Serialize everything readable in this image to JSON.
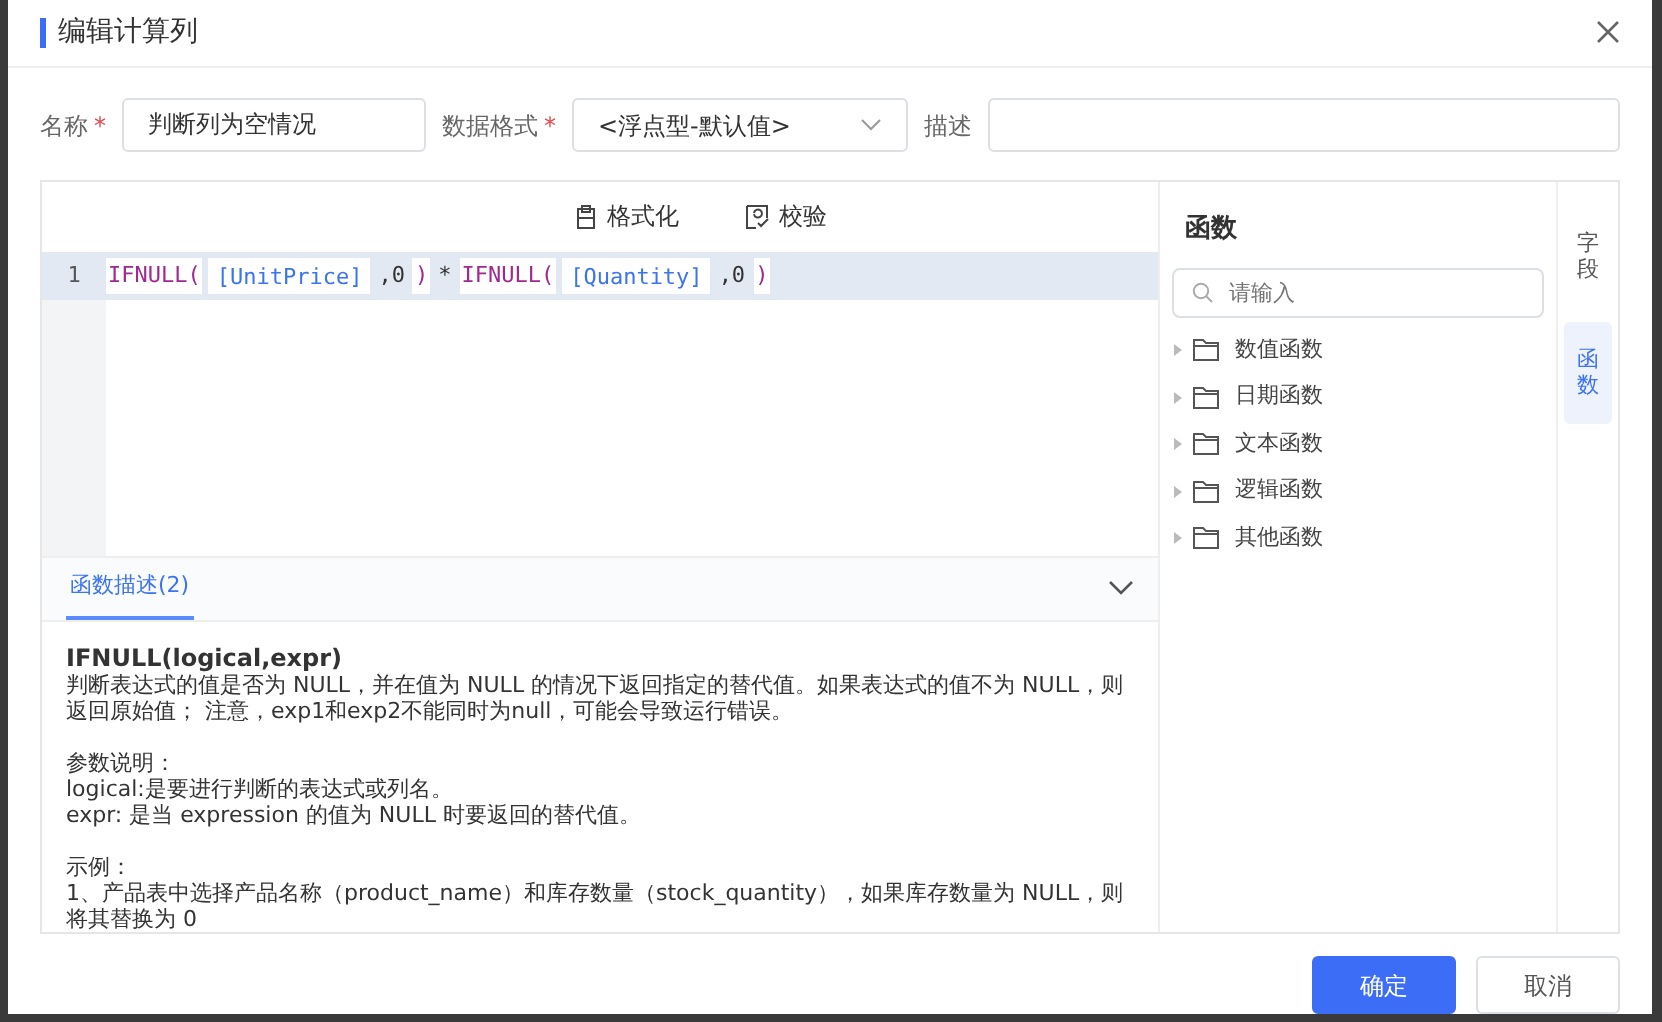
{
  "dialog": {
    "title": "编辑计算列"
  },
  "form": [
    {
      "label": "名称",
      "required": true,
      "kind": "input",
      "value": "判断列为空情况"
    },
    {
      "label": "数据格式",
      "required": true,
      "kind": "select",
      "value": "<浮点型-默认值>"
    },
    {
      "label": "描述",
      "required": false,
      "kind": "input"
    }
  ],
  "toolbar": [
    {
      "label": "格式化",
      "kind": "format"
    },
    {
      "label": "校验",
      "kind": "check"
    }
  ],
  "editor": {
    "lines": [
      {
        "number": "1",
        "tokens": [
          {
            "kind": "func",
            "text": "IFNULL("
          },
          {
            "kind": "field",
            "text": "[UnitPrice]"
          },
          {
            "kind": "plain",
            "text": ",0"
          },
          {
            "kind": "func",
            "text": ")"
          },
          {
            "kind": "plain",
            "text": "*"
          },
          {
            "kind": "func",
            "text": "IFNULL("
          },
          {
            "kind": "field",
            "text": "[Quantity]"
          },
          {
            "kind": "plain",
            "text": ",0"
          },
          {
            "kind": "func",
            "text": ")"
          }
        ]
      }
    ]
  },
  "description": {
    "tab": {
      "label": "函数描述(2)",
      "selected": true
    },
    "paragraphs": [
      {
        "kind": "signature",
        "text": "IFNULL(logical,expr)"
      },
      {
        "kind": "text",
        "text": "判断表达式的值是否为 NULL，并在值为 NULL 的情况下返回指定的替代值。如果表达式的值不为 NULL，则返回原始值； 注意，exp1和exp2不能同时为null，可能会导致运行错误。"
      },
      {
        "kind": "gap"
      },
      {
        "kind": "text",
        "text": "参数说明："
      },
      {
        "kind": "text",
        "text": "logical:是要进行判断的表达式或列名。"
      },
      {
        "kind": "text",
        "text": "expr: 是当 expression 的值为 NULL 时要返回的替代值。"
      },
      {
        "kind": "gap"
      },
      {
        "kind": "text",
        "text": "示例："
      },
      {
        "kind": "text",
        "text": "1、产品表中选择产品名称（product_name）和库存数量（stock_quantity），如果库存数量为 NULL，则将其替换为 0"
      }
    ]
  },
  "functions": {
    "title": "函数",
    "search": {
      "placeholder": "请输入"
    },
    "folders": [
      {
        "label": "数值函数",
        "expanded": false
      },
      {
        "label": "日期函数",
        "expanded": false
      },
      {
        "label": "文本函数",
        "expanded": false
      },
      {
        "label": "逻辑函数",
        "expanded": false
      },
      {
        "label": "其他函数",
        "expanded": false
      }
    ]
  },
  "side_tabs": [
    {
      "label": "字段",
      "selected": false
    },
    {
      "label": "函数",
      "selected": true
    }
  ],
  "buttons": [
    {
      "label": "确定",
      "kind": "primary"
    },
    {
      "label": "取消",
      "kind": "secondary"
    }
  ]
}
